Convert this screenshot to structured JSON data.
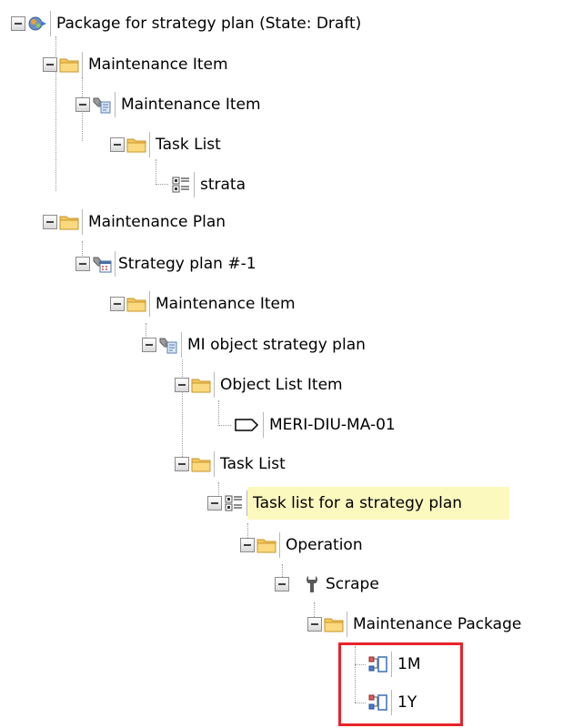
{
  "tree": {
    "nodes": [
      {
        "id": "root",
        "label": "Package for strategy plan (State: Draft)",
        "icon": "package-icon"
      },
      {
        "id": "mi-folder",
        "label": "Maintenance Item",
        "icon": "folder-icon"
      },
      {
        "id": "mi",
        "label": "Maintenance Item",
        "icon": "maintenance-item-icon"
      },
      {
        "id": "tl-folder-1",
        "label": "Task List",
        "icon": "folder-icon"
      },
      {
        "id": "strata",
        "label": "strata",
        "icon": "task-list-icon"
      },
      {
        "id": "mp-folder",
        "label": "Maintenance Plan",
        "icon": "folder-icon"
      },
      {
        "id": "sp",
        "label": "Strategy plan #-1",
        "icon": "strategy-plan-icon"
      },
      {
        "id": "mi-folder-2",
        "label": "Maintenance Item",
        "icon": "folder-icon"
      },
      {
        "id": "mi-obj",
        "label": "MI object strategy plan",
        "icon": "maintenance-item-icon"
      },
      {
        "id": "oli-folder",
        "label": "Object List Item",
        "icon": "folder-icon"
      },
      {
        "id": "meri",
        "label": "MERI-DIU-MA-01",
        "icon": "tag-icon"
      },
      {
        "id": "tl-folder-2",
        "label": "Task List",
        "icon": "folder-icon"
      },
      {
        "id": "tl-strategy",
        "label": "Task list for a strategy plan",
        "icon": "task-list-icon",
        "selected": true
      },
      {
        "id": "op-folder",
        "label": "Operation",
        "icon": "folder-icon"
      },
      {
        "id": "scrape",
        "label": "Scrape",
        "icon": "wrench-icon"
      },
      {
        "id": "mpkg-folder",
        "label": "Maintenance Package",
        "icon": "folder-icon"
      },
      {
        "id": "1m",
        "label": "1M",
        "icon": "package-cycle-icon"
      },
      {
        "id": "1y",
        "label": "1Y",
        "icon": "package-cycle-icon"
      }
    ]
  },
  "colors": {
    "selection_background": "#fcf9bf",
    "highlight_border": "#e8232a",
    "folder_yellow": "#f6c75a"
  }
}
